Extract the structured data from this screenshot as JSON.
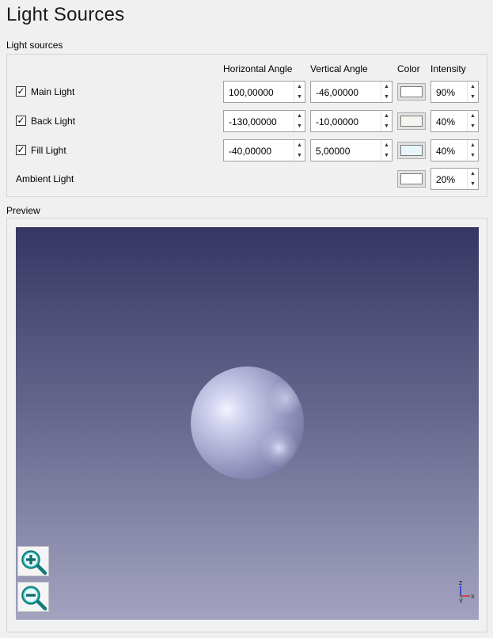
{
  "title": "Light Sources",
  "light_sources_group": {
    "label": "Light sources",
    "headers": {
      "horizontal_angle": "Horizontal Angle",
      "vertical_angle": "Vertical Angle",
      "color": "Color",
      "intensity": "Intensity"
    },
    "rows": [
      {
        "label": "Main Light",
        "checked": true,
        "checkmark": "✓",
        "horizontal": "100,00000",
        "vertical": "-46,00000",
        "color": "#ffffff",
        "intensity": "90%"
      },
      {
        "label": "Back Light",
        "checked": true,
        "checkmark": "✓",
        "horizontal": "-130,00000",
        "vertical": "-10,00000",
        "color": "#f5f5ef",
        "intensity": "40%"
      },
      {
        "label": "Fill Light",
        "checked": true,
        "checkmark": "✓",
        "horizontal": "-40,00000",
        "vertical": "5,00000",
        "color": "#e6f6fc",
        "intensity": "40%"
      },
      {
        "label": "Ambient Light",
        "color": "#ffffff",
        "intensity": "20%"
      }
    ]
  },
  "preview": {
    "label": "Preview",
    "axis_labels": {
      "z": "Z",
      "y": "Y",
      "x": "X"
    }
  },
  "colors": {
    "viewport_top": "#363663",
    "viewport_bottom": "#a3a3c0",
    "sphere": "#b1b3d6",
    "zoom_icon": "#1fa3a3"
  },
  "icons": [
    "zoom-in-icon",
    "zoom-out-icon",
    "axes-triad-icon",
    "spin-up-icon",
    "spin-down-icon",
    "checkmark-icon"
  ]
}
